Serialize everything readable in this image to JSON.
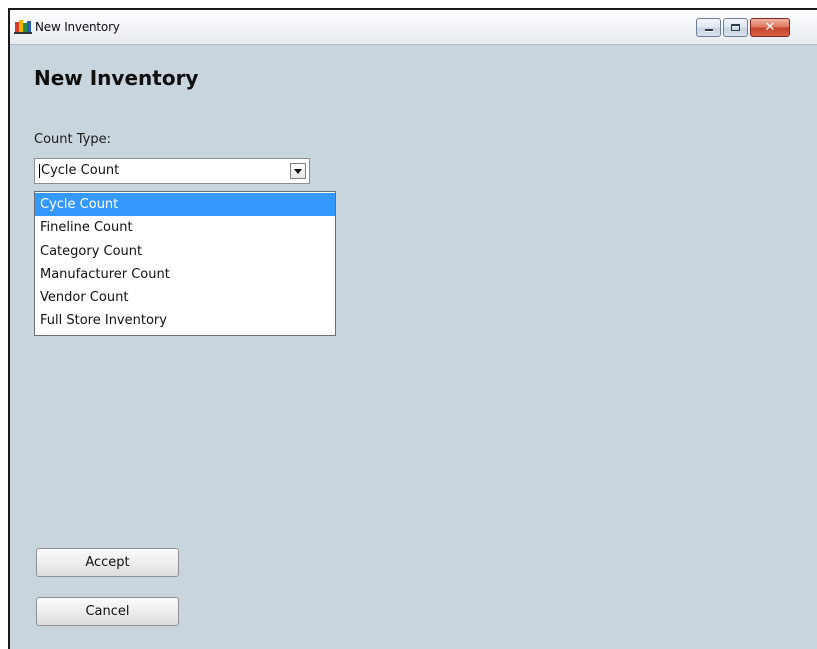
{
  "window": {
    "title": "New Inventory",
    "icon": "app-icon",
    "controls": {
      "minimize_icon": "minimize-icon",
      "maximize_icon": "maximize-icon",
      "close_icon": "close-icon",
      "close_glyph": "✕"
    }
  },
  "form": {
    "heading": "New Inventory",
    "count_type_label": "Count Type:",
    "count_type": {
      "selected": "Cycle Count",
      "options": [
        "Cycle Count",
        "Fineline Count",
        "Category Count",
        "Manufacturer Count",
        "Vendor Count",
        "Full Store Inventory"
      ],
      "highlighted": "Cycle Count"
    },
    "accept_label": "Accept",
    "cancel_label": "Cancel"
  },
  "colors": {
    "background": "#c9d5dc",
    "selection": "#3399ff",
    "close_button": "#c5432b"
  }
}
